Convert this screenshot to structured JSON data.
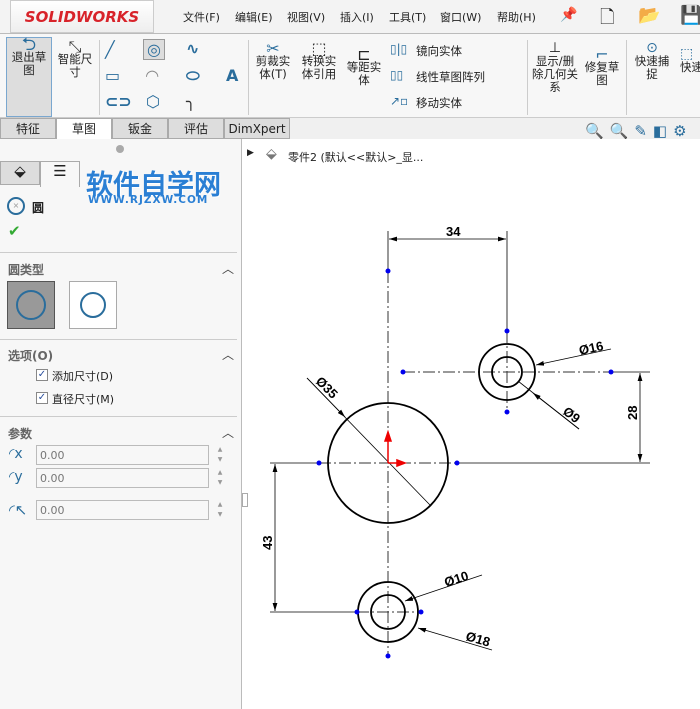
{
  "app": {
    "logo": "SOLIDWORKS"
  },
  "menu": [
    "文件(F)",
    "编辑(E)",
    "视图(V)",
    "插入(I)",
    "工具(T)",
    "窗口(W)",
    "帮助(H)"
  ],
  "ribbon": {
    "exit_sketch": "退出草图",
    "smart_dim": "智能尺寸",
    "trim": "剪裁实体(T)",
    "convert": "转换实体引用",
    "offset": "等距实体",
    "mirror": "镜向实体",
    "linear_pattern": "线性草图阵列",
    "move": "移动实体",
    "show_delete": "显示/删除几何关系",
    "repair": "修复草图",
    "quick_snap": "快速捕捉",
    "quick_view": "快速"
  },
  "tabs": [
    "特征",
    "草图",
    "钣金",
    "评估",
    "DimXpert"
  ],
  "active_tab": "草图",
  "watermark": {
    "title": "软件自学网",
    "url": "WWW.RJZXW.COM"
  },
  "panel": {
    "title": "圆",
    "circle_type": "圆类型",
    "options": "选项(O)",
    "add_dim": "添加尺寸(D)",
    "dia_dim": "直径尺寸(M)",
    "params": "参数",
    "cx": "0.00",
    "cy": "0.00",
    "radius": "0.00",
    "add_dim_checked": true,
    "dia_dim_checked": true
  },
  "tree": {
    "label": "零件2  (默认<<默认>_显..."
  },
  "dimensions": {
    "d34": "34",
    "d28": "28",
    "d43": "43",
    "dia35": "Ø35",
    "dia16": "Ø16",
    "dia9": "Ø9",
    "dia10": "Ø10",
    "dia18": "Ø18"
  },
  "colors": {
    "accent": "#2a6d9c",
    "point": "#0000ee",
    "origin": "#ee0000"
  }
}
